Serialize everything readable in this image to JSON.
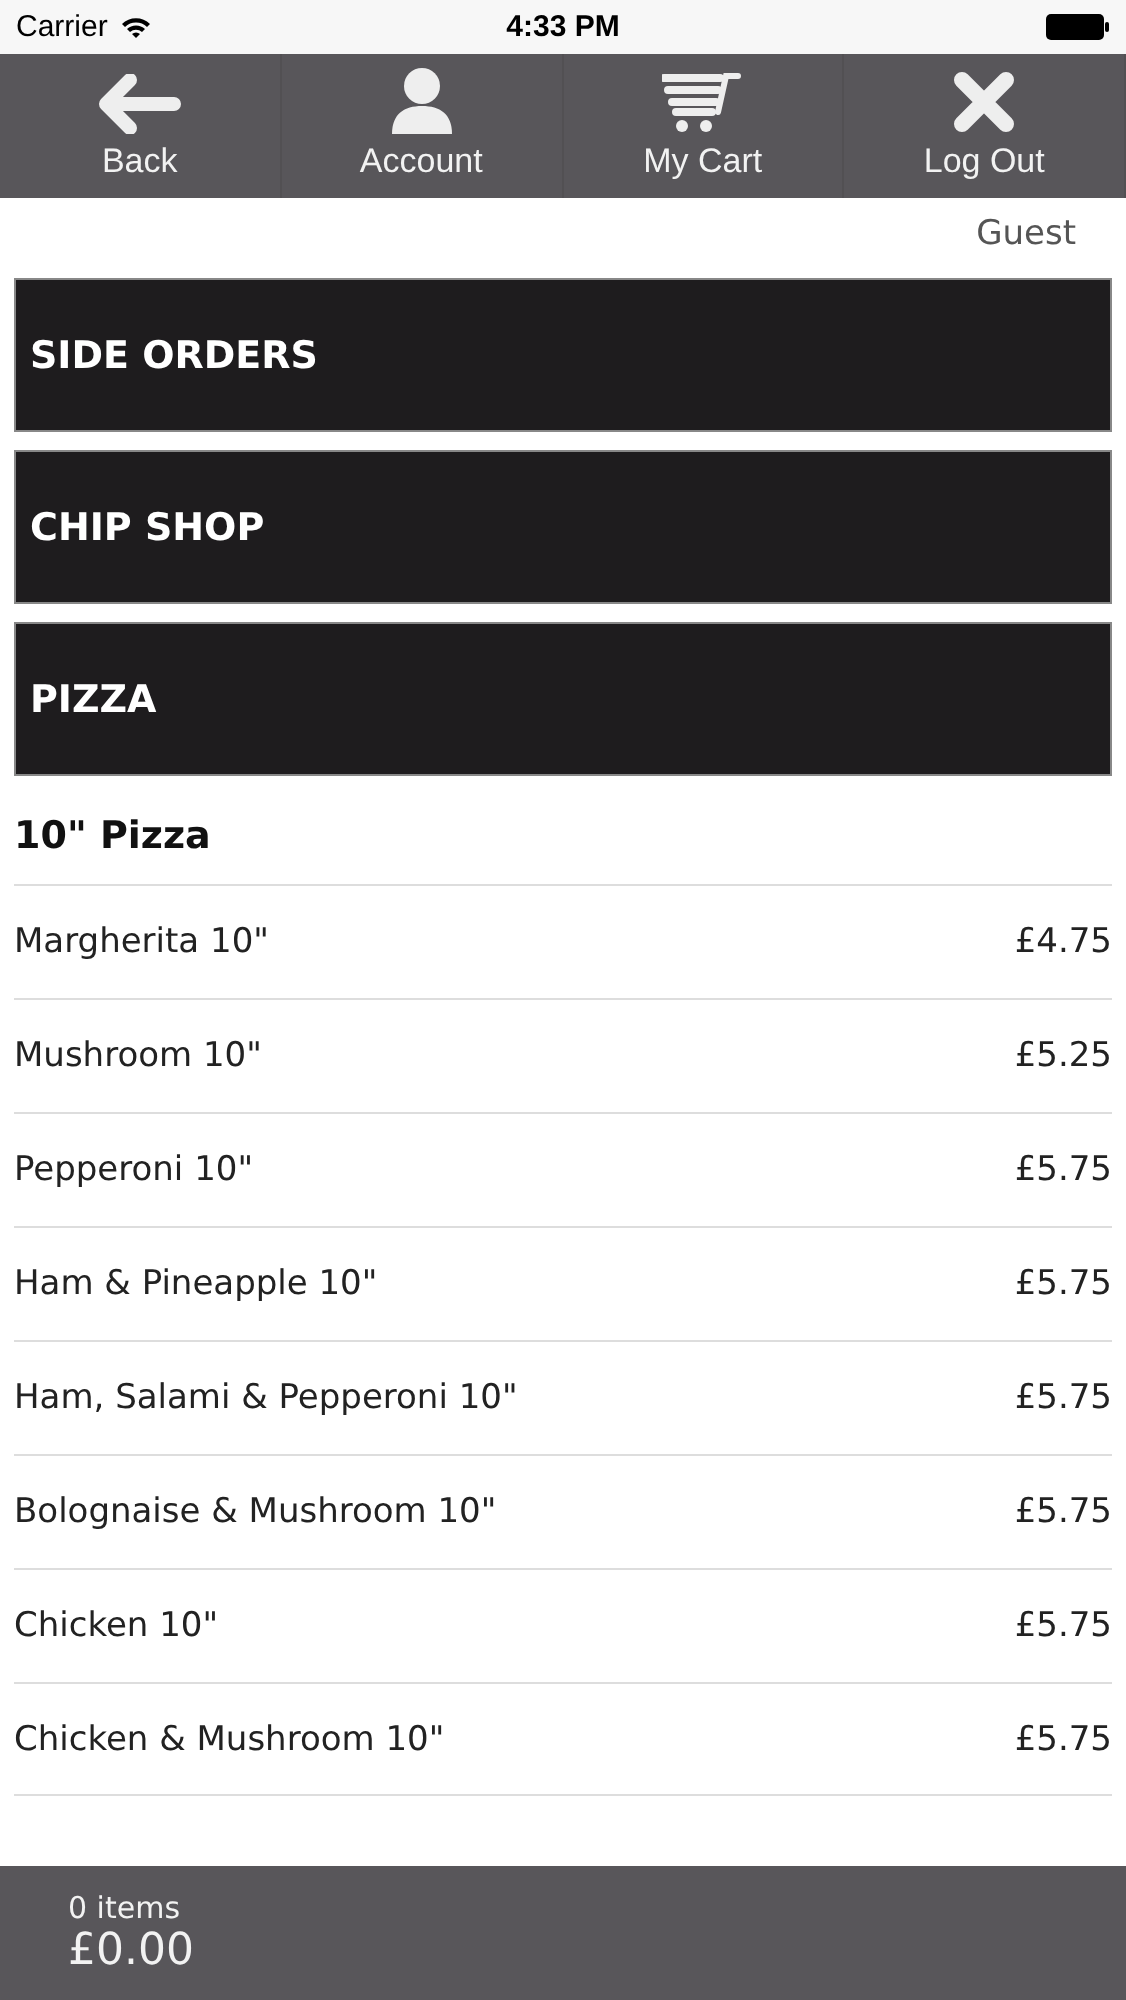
{
  "status_bar": {
    "carrier": "Carrier",
    "time": "4:33 PM"
  },
  "nav": [
    {
      "label": "Back",
      "kind": "back"
    },
    {
      "label": "Account",
      "kind": "account"
    },
    {
      "label": "My Cart",
      "kind": "cart"
    },
    {
      "label": "Log Out",
      "kind": "close"
    }
  ],
  "user": "Guest",
  "categories": [
    "SIDE ORDERS",
    "CHIP SHOP",
    "PIZZA"
  ],
  "section_title": "10\" Pizza",
  "items": [
    {
      "name": "Margherita 10\"",
      "price": "£4.75"
    },
    {
      "name": "Mushroom 10\"",
      "price": "£5.25"
    },
    {
      "name": "Pepperoni 10\"",
      "price": "£5.75"
    },
    {
      "name": "Ham & Pineapple 10\"",
      "price": "£5.75"
    },
    {
      "name": "Ham, Salami & Pepperoni 10\"",
      "price": "£5.75"
    },
    {
      "name": "Bolognaise & Mushroom 10\"",
      "price": "£5.75"
    },
    {
      "name": "Chicken 10\"",
      "price": "£5.75"
    },
    {
      "name": "Chicken & Mushroom 10\"",
      "price": "£5.75"
    }
  ],
  "cart": {
    "count": "0 items",
    "total": "£0.00"
  }
}
